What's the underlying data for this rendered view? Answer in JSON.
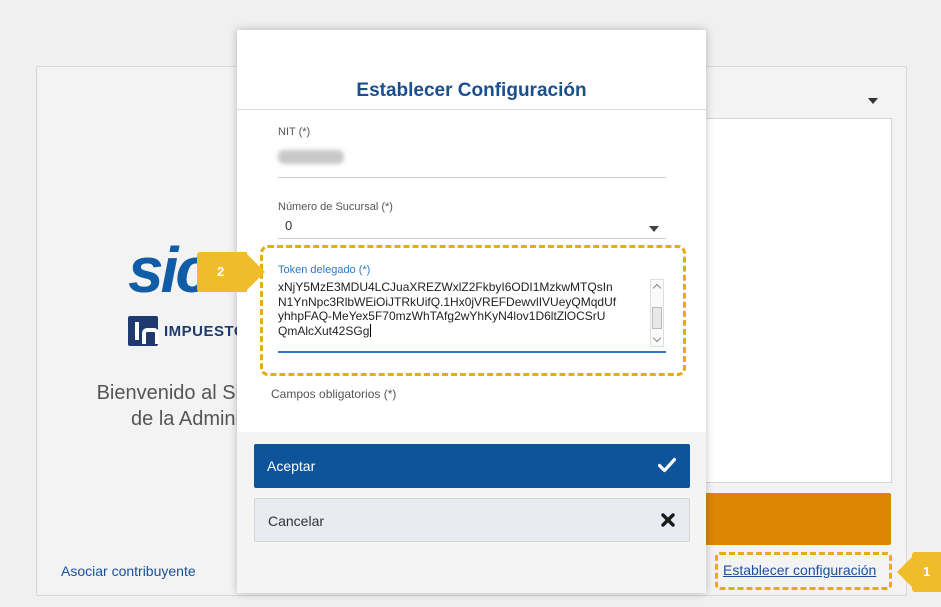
{
  "background": {
    "logo_text": "sic",
    "brand_text": "IMPUESTOS",
    "welcome_line1": "Bienvenido al Si",
    "welcome_line2": "de la Admini",
    "associate_link": "Asociar contribuyente",
    "establish_link": "Establecer configuración"
  },
  "modal": {
    "title": "Establecer Configuración",
    "nit": {
      "label": "NIT (*)",
      "value": ""
    },
    "branch": {
      "label": "Número de Sucursal (*)",
      "value": "0"
    },
    "token": {
      "label": "Token delegado (*)",
      "lines": [
        "xNjY5MzE3MDU4LCJuaXREZWxlZ2FkbyI6ODI1MzkwMTQsIn",
        "N1YnNpc3RlbWEiOiJTRkUifQ.1Hx0jVREFDewvlIVUeyQMqdUf",
        "yhhpFAQ-MeYex5F70mzWhTAfg2wYhKyN4lov1D6ltZlOCSrU",
        "QmAlcXut42SGg"
      ]
    },
    "required_note": "Campos obligatorios (*)",
    "accept_label": "Aceptar",
    "cancel_label": "Cancelar"
  },
  "callouts": {
    "step1": "1",
    "step2": "2"
  },
  "colors": {
    "primary": "#0d549b",
    "callout": "#f0bc2a",
    "orange": "#db8704"
  }
}
